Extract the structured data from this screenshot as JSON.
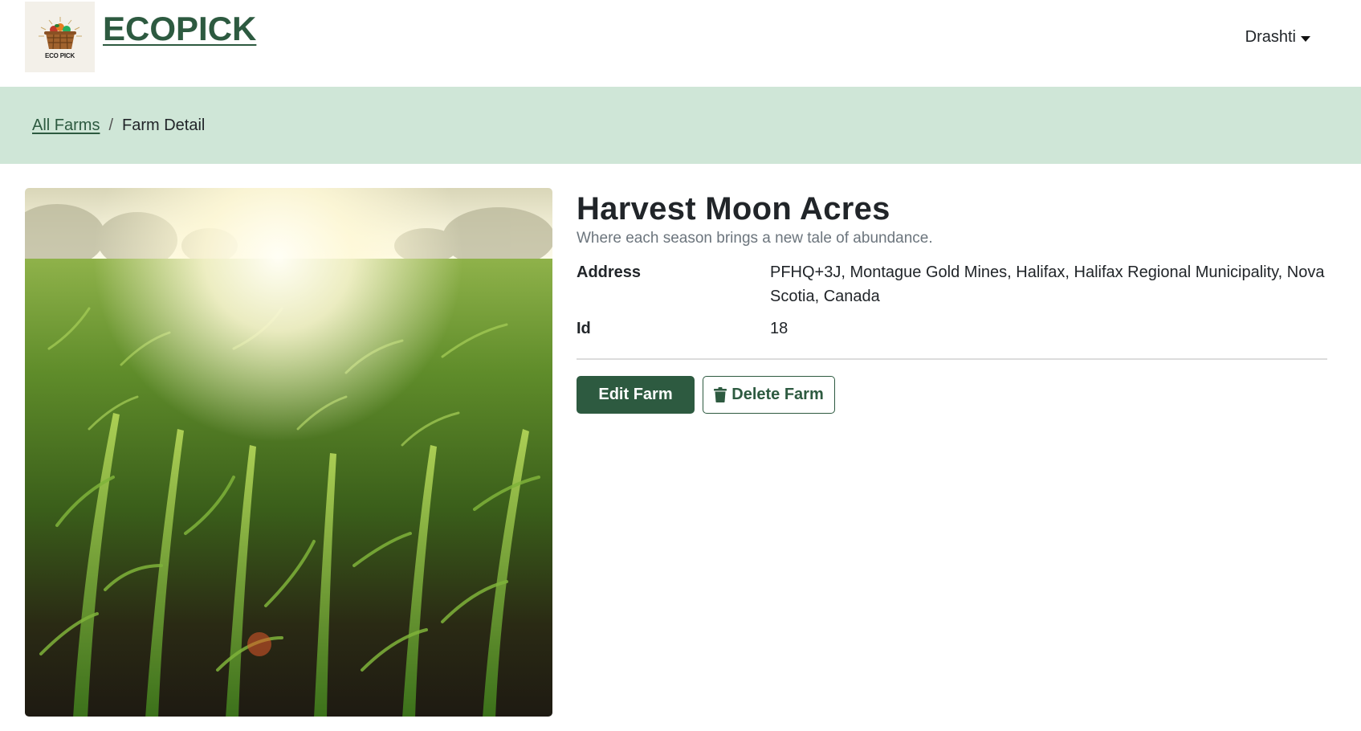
{
  "header": {
    "logo_text": "ECO PICK",
    "brand": "ECOPICK",
    "user_name": "Drashti"
  },
  "breadcrumb": {
    "parent_label": "All Farms",
    "separator": "/",
    "current_label": "Farm Detail"
  },
  "farm": {
    "name": "Harvest Moon Acres",
    "tagline": "Where each season brings a new tale of abundance.",
    "address_label": "Address",
    "address_value": "PFHQ+3J, Montague Gold Mines, Halifax, Halifax Regional Municipality, Nova Scotia, Canada",
    "id_label": "Id",
    "id_value": "18"
  },
  "actions": {
    "edit_label": "Edit Farm",
    "delete_label": "Delete Farm"
  },
  "colors": {
    "brand_green": "#2d5a40",
    "breadcrumb_bg": "#cfe6d7",
    "muted_text": "#6c757d"
  },
  "icons": {
    "user_caret": "caret-down-icon",
    "delete": "trash-icon",
    "logo": "basket-icon"
  }
}
